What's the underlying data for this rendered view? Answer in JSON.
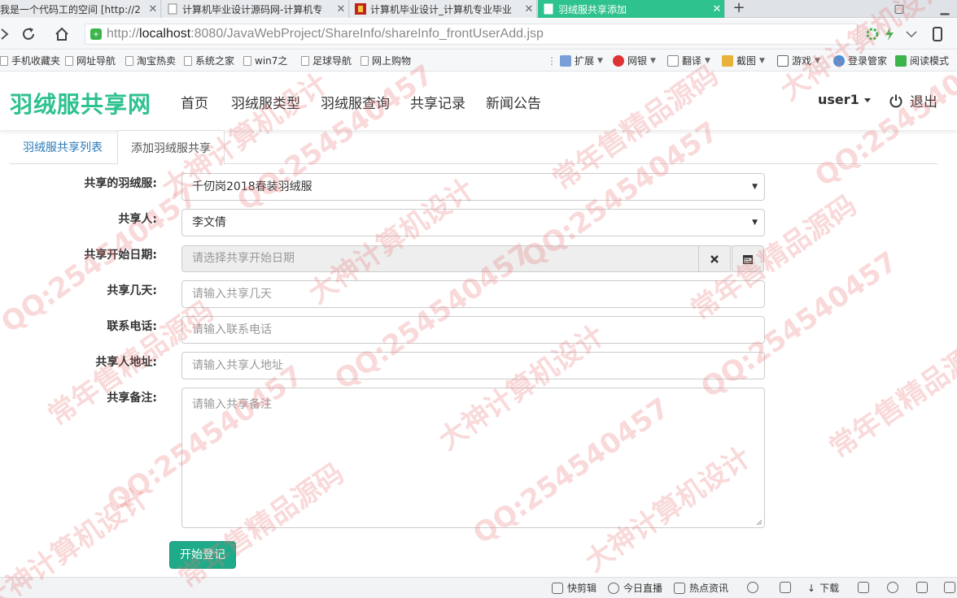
{
  "browser": {
    "tabs": [
      {
        "title": "我是一个代码工的空间 [http://2",
        "active": false
      },
      {
        "title": "计算机毕业设计源码网-计算机专",
        "active": false
      },
      {
        "title": "计算机毕业设计_计算机专业毕业",
        "active": false
      },
      {
        "title": "羽绒服共享添加",
        "active": true
      }
    ],
    "new_tab_label": "+",
    "url_prefix": "http://",
    "url_host": "localhost",
    "url_path": ":8080/JavaWebProject/ShareInfo/shareInfo_frontUserAdd.jsp",
    "bookmarks": [
      "手机收藏夹",
      "网址导航",
      "淘宝热卖",
      "系统之家",
      "win7之",
      "足球导航",
      "网上购物"
    ],
    "bookmark_tools": [
      "扩展",
      "网银",
      "翻译",
      "截图",
      "游戏",
      "登录管家",
      "阅读模式"
    ]
  },
  "header": {
    "brand": "羽绒服共享网",
    "nav": [
      "首页",
      "羽绒服类型",
      "羽绒服查询",
      "共享记录",
      "新闻公告"
    ],
    "user": "user1",
    "logout": "退出"
  },
  "tabs": {
    "list": "羽绒服共享列表",
    "add": "添加羽绒服共享"
  },
  "form": {
    "clothes_label": "共享的羽绒服:",
    "clothes_value": "千仞岗2018春装羽绒服",
    "person_label": "共享人:",
    "person_value": "李文倩",
    "start_date_label": "共享开始日期:",
    "start_date_placeholder": "请选择共享开始日期",
    "days_label": "共享几天:",
    "days_placeholder": "请输入共享几天",
    "phone_label": "联系电话:",
    "phone_placeholder": "请输入联系电话",
    "address_label": "共享人地址:",
    "address_placeholder": "请输入共享人地址",
    "memo_label": "共享备注:",
    "memo_placeholder": "请输入共享备注",
    "submit": "开始登记"
  },
  "statusbar": [
    "快剪辑",
    "今日直播",
    "热点资讯",
    "下载"
  ],
  "watermark": [
    "QQ:254540457",
    "常年售精品源码",
    "大神计算机设计"
  ],
  "colors": {
    "accent": "#2ec28e",
    "button": "#1fab89",
    "link": "#2a7ab8"
  }
}
